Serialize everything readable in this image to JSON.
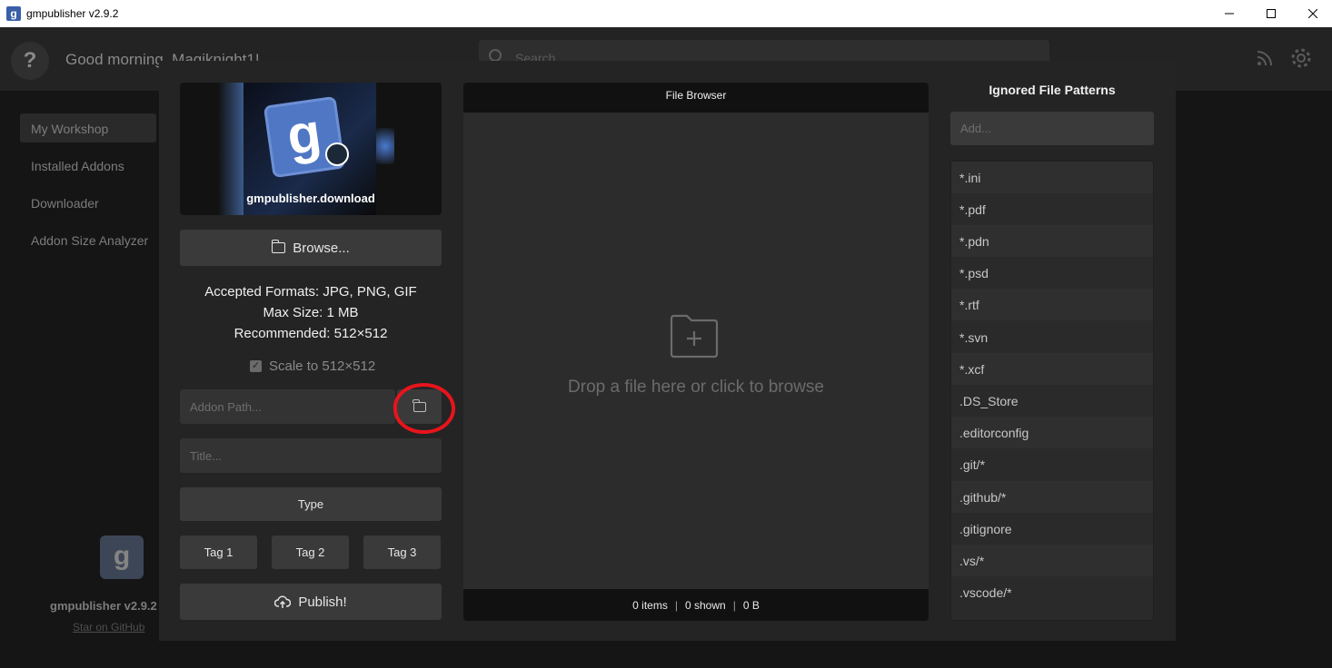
{
  "window": {
    "title": "gmpublisher v2.9.2",
    "app_icon_letter": "g"
  },
  "header": {
    "help_glyph": "?",
    "greeting": "Good morning, Magiknight1!",
    "search_placeholder": "Search..."
  },
  "sidebar": {
    "items": [
      {
        "label": "My Workshop",
        "active": true
      },
      {
        "label": "Installed Addons",
        "active": false
      },
      {
        "label": "Downloader",
        "active": false
      },
      {
        "label": "Addon Size Analyzer",
        "active": false
      }
    ],
    "logo_letter": "g",
    "version": "gmpublisher v2.9.2",
    "github_link": "Star on GitHub"
  },
  "publish_modal": {
    "preview": {
      "logo_letter": "g",
      "caption": "gmpublisher.download"
    },
    "browse_label": "Browse...",
    "accepted_formats": "Accepted Formats: JPG, PNG, GIF",
    "max_size": "Max Size: 1 MB",
    "recommended": "Recommended: 512×512",
    "scale_label": "Scale to 512×512",
    "scale_checked": true,
    "addon_path_placeholder": "Addon Path...",
    "title_placeholder": "Title...",
    "type_label": "Type",
    "tags": [
      "Tag 1",
      "Tag 2",
      "Tag 3"
    ],
    "publish_label": "Publish!"
  },
  "file_browser": {
    "title": "File Browser",
    "drop_text": "Drop a file here or click to browse",
    "items": "0 items",
    "shown": "0 shown",
    "size": "0 B",
    "separator": "|"
  },
  "ignored_patterns": {
    "title": "Ignored File Patterns",
    "add_placeholder": "Add...",
    "patterns": [
      "*.ini",
      "*.pdf",
      "*.pdn",
      "*.psd",
      "*.rtf",
      "*.svn",
      "*.xcf",
      ".DS_Store",
      ".editorconfig",
      ".git/*",
      ".github/*",
      ".gitignore",
      ".vs/*",
      ".vscode/*"
    ]
  },
  "colors": {
    "highlight_ring": "#e8141c",
    "modal_bg": "#242424",
    "button_bg": "#3a3a3a"
  }
}
